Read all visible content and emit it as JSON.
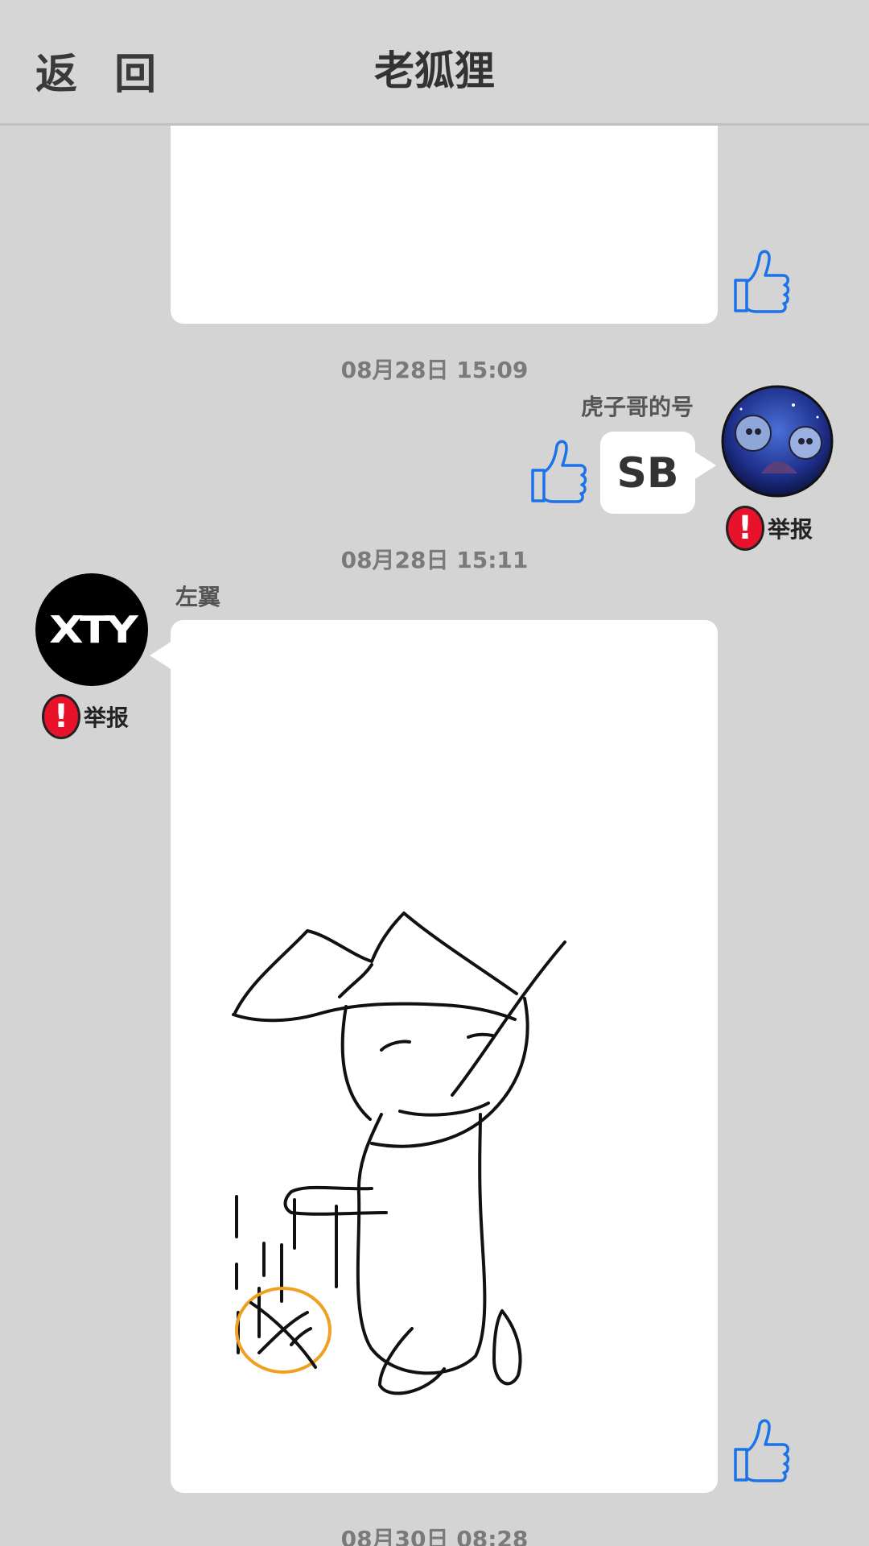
{
  "header": {
    "back_label": "返 回",
    "title": "老狐狸"
  },
  "messages": [
    {
      "timestamp": "08月28日  15:09",
      "sender": "虎子哥的号",
      "text": "SB",
      "report_label": "举报"
    },
    {
      "timestamp": "08月28日  15:11",
      "sender": "左翼",
      "avatar_text": "XTY",
      "report_label": "举报"
    },
    {
      "timestamp": "08月30日  08:28"
    }
  ],
  "colors": {
    "background": "#d4d4d4",
    "bubble": "#ffffff",
    "like_blue": "#1a73e8",
    "report_red": "#e8132a"
  }
}
